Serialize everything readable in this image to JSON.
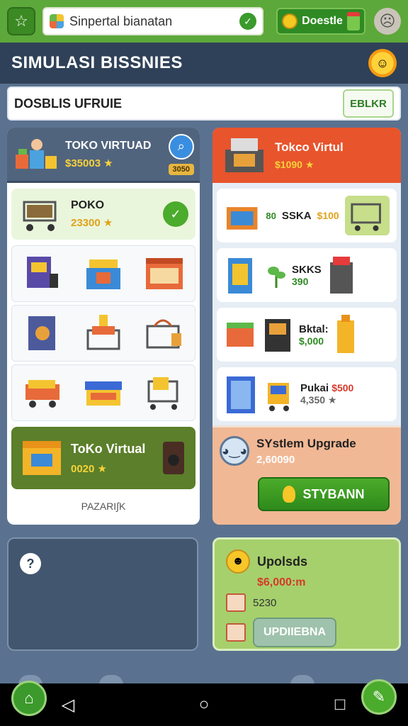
{
  "topbar": {
    "search_text": "Sinpertal bianatan",
    "doodle_label": "Doestle"
  },
  "title": "SIMULASI BISSNIES",
  "banner": {
    "text": "DOSBLIS UFRUIE",
    "button_label": "EBLKR"
  },
  "left_panel": {
    "header": {
      "title": "TOKO VIRTUAD",
      "price": "$35003",
      "badge": "3050"
    },
    "poko": {
      "title": "POKO",
      "price": "23300"
    },
    "green_card": {
      "title": "ToKo Virtual",
      "price": "0020"
    },
    "footer_label": "PAZARI∫K"
  },
  "right_panel": {
    "header": {
      "title": "Tokco Virtul",
      "price": "$1090"
    },
    "rows": [
      {
        "label": "SSKA",
        "value": "$100",
        "prefix": "80"
      },
      {
        "label": "SKKS",
        "value": "390"
      },
      {
        "label": "Bktal:",
        "value": "$,000"
      },
      {
        "label": "Pukai",
        "value": "$500",
        "sub": "4,350"
      }
    ],
    "upgrade": {
      "title": "SYstlem Upgrade",
      "price": "2,60090",
      "button_label": "STYBANN"
    }
  },
  "upload_panel": {
    "title": "Upolsds",
    "price": "$6,000:m",
    "count": "5230",
    "button_label": "UPDIIEBNA"
  },
  "colors": {
    "topbar": "#5da83a",
    "title_bg": "#2f4158",
    "accent_red": "#e8542c",
    "accent_green": "#4aab2c"
  }
}
